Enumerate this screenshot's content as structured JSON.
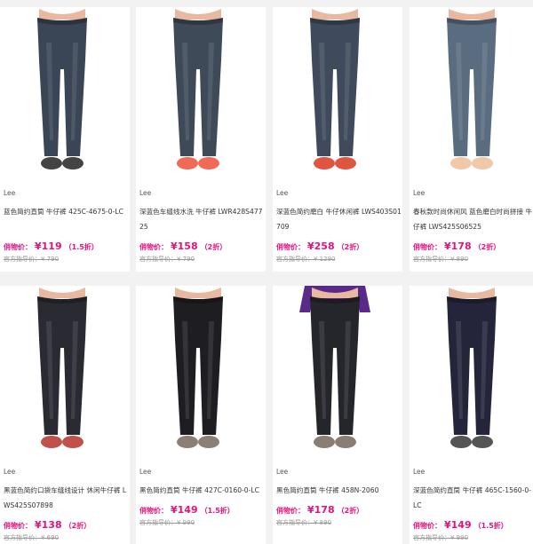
{
  "products": [
    {
      "brand": "Lee",
      "title": "蓝色简约直筒 牛仔裤 425C-4675-0-LC",
      "price_label": "俏物价：",
      "currency": "¥",
      "price": "119",
      "discount": "（1.5折）",
      "ref_label": "官方指导价：",
      "ref_price": "¥ 790",
      "denim": "#3a4555",
      "shoe": "#444"
    },
    {
      "brand": "Lee",
      "title": "深蓝色车缝线水洗 牛仔裤 LWR428S47725",
      "price_label": "俏物价：",
      "currency": "¥",
      "price": "158",
      "discount": "（2折）",
      "ref_label": "官方指导价：",
      "ref_price": "¥ 790",
      "denim": "#3e4a58",
      "shoe": "#f06a55"
    },
    {
      "brand": "Lee",
      "title": "深蓝色简约磨白 牛仔休闲裤 LWS403S01709",
      "price_label": "俏物价：",
      "currency": "¥",
      "price": "258",
      "discount": "（2折）",
      "ref_label": "官方指导价：",
      "ref_price": "¥ 1290",
      "denim": "#3f4b5c",
      "shoe": "#e0553f"
    },
    {
      "brand": "Lee",
      "title": "春秋款时尚休闲风 蓝色磨白时尚拼接 牛仔裤 LWS425S06525",
      "price_label": "俏物价：",
      "currency": "¥",
      "price": "178",
      "discount": "（2折）",
      "ref_label": "官方指导价：",
      "ref_price": "¥ 890",
      "denim": "#5a6c80",
      "shoe": "#f2c9a8"
    },
    {
      "brand": "Lee",
      "title": "黑蓝色简约口袋车缝线设计 休闲牛仔裤 LWS425S07898",
      "price_label": "俏物价：",
      "currency": "¥",
      "price": "138",
      "discount": "（2折）",
      "ref_label": "官方指导价：",
      "ref_price": "¥ 690",
      "denim": "#2a2a33",
      "shoe": "#c0504a"
    },
    {
      "brand": "Lee",
      "title": "黑色简约直筒 牛仔裤 427C-0160-0-LC",
      "price_label": "俏物价：",
      "currency": "¥",
      "price": "149",
      "discount": "（1.5折）",
      "ref_label": "官方指导价：",
      "ref_price": "¥ 990",
      "denim": "#1e1e22",
      "shoe": "#8c7f76"
    },
    {
      "brand": "Lee",
      "title": "黑色简约直筒 牛仔裤 458N-2060",
      "price_label": "俏物价：",
      "currency": "¥",
      "price": "178",
      "discount": "（2折）",
      "ref_label": "官方指导价：",
      "ref_price": "¥ 890",
      "denim": "#25252c",
      "shoe": "#8a7d74",
      "top": "#5a2a8a"
    },
    {
      "brand": "Lee",
      "title": "深蓝色简约直筒 牛仔裤 465C-1560-0-LC",
      "price_label": "俏物价：",
      "currency": "¥",
      "price": "149",
      "discount": "（1.5折）",
      "ref_label": "官方指导价：",
      "ref_price": "¥ 990",
      "denim": "#24253a",
      "shoe": "#555"
    }
  ]
}
